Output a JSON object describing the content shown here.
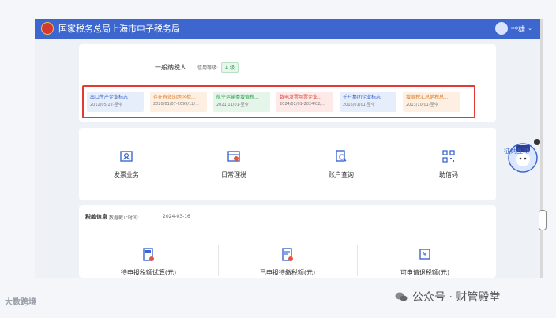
{
  "header": {
    "title": "国家税务总局上海市电子税务局",
    "user_name": "**雄",
    "chevron": "chevron-down-icon"
  },
  "profile": {
    "taxpayer_type": "一般纳税人",
    "credit_label": "信用等级:",
    "credit_grade": "A 级",
    "tags": [
      {
        "name": "出口生产企业标志",
        "date": "2012/05/22-至今",
        "bg": "#e6eefc",
        "color": "#3a62c8"
      },
      {
        "name": "存在有效的跨区检...",
        "date": "2020/01/07-2099/12/...",
        "bg": "#fdf0e2",
        "color": "#d97a2b"
      },
      {
        "name": "航空运输类增值税...",
        "date": "2021/11/01-至今",
        "bg": "#e6f5ea",
        "color": "#2e9d4d"
      },
      {
        "name": "数电发票用票企业...",
        "date": "2024/02/01-2024/02/...",
        "bg": "#fde9e7",
        "color": "#d9453a"
      },
      {
        "name": "千户集团企业标志",
        "date": "2016/01/01-至今",
        "bg": "#e6eefc",
        "color": "#3a62c8"
      },
      {
        "name": "增值税汇总纳税总...",
        "date": "2013/10/01-至今",
        "bg": "#fdf0e2",
        "color": "#d97a2b"
      }
    ]
  },
  "quick": [
    {
      "label": "发票业务",
      "icon": "invoice-icon"
    },
    {
      "label": "日常理税",
      "icon": "calendar-tax-icon"
    },
    {
      "label": "账户查询",
      "icon": "search-doc-icon"
    },
    {
      "label": "助信码",
      "icon": "qr-code-icon"
    }
  ],
  "tax_info": {
    "title": "税款信息",
    "date_label": "数据截止时间:",
    "date": "2024-03-16",
    "items": [
      {
        "label": "待申报税额试算(元)",
        "icon": "calculator-icon"
      },
      {
        "label": "已申报待缴税额(元)",
        "icon": "payment-doc-icon"
      },
      {
        "label": "可申请退税额(元)",
        "icon": "refund-icon"
      }
    ]
  },
  "watermark": {
    "left": "大数跨境",
    "right": "公众号 · 财管殿堂"
  },
  "robot_text": "征纳互动",
  "accent": "#3d67cf"
}
